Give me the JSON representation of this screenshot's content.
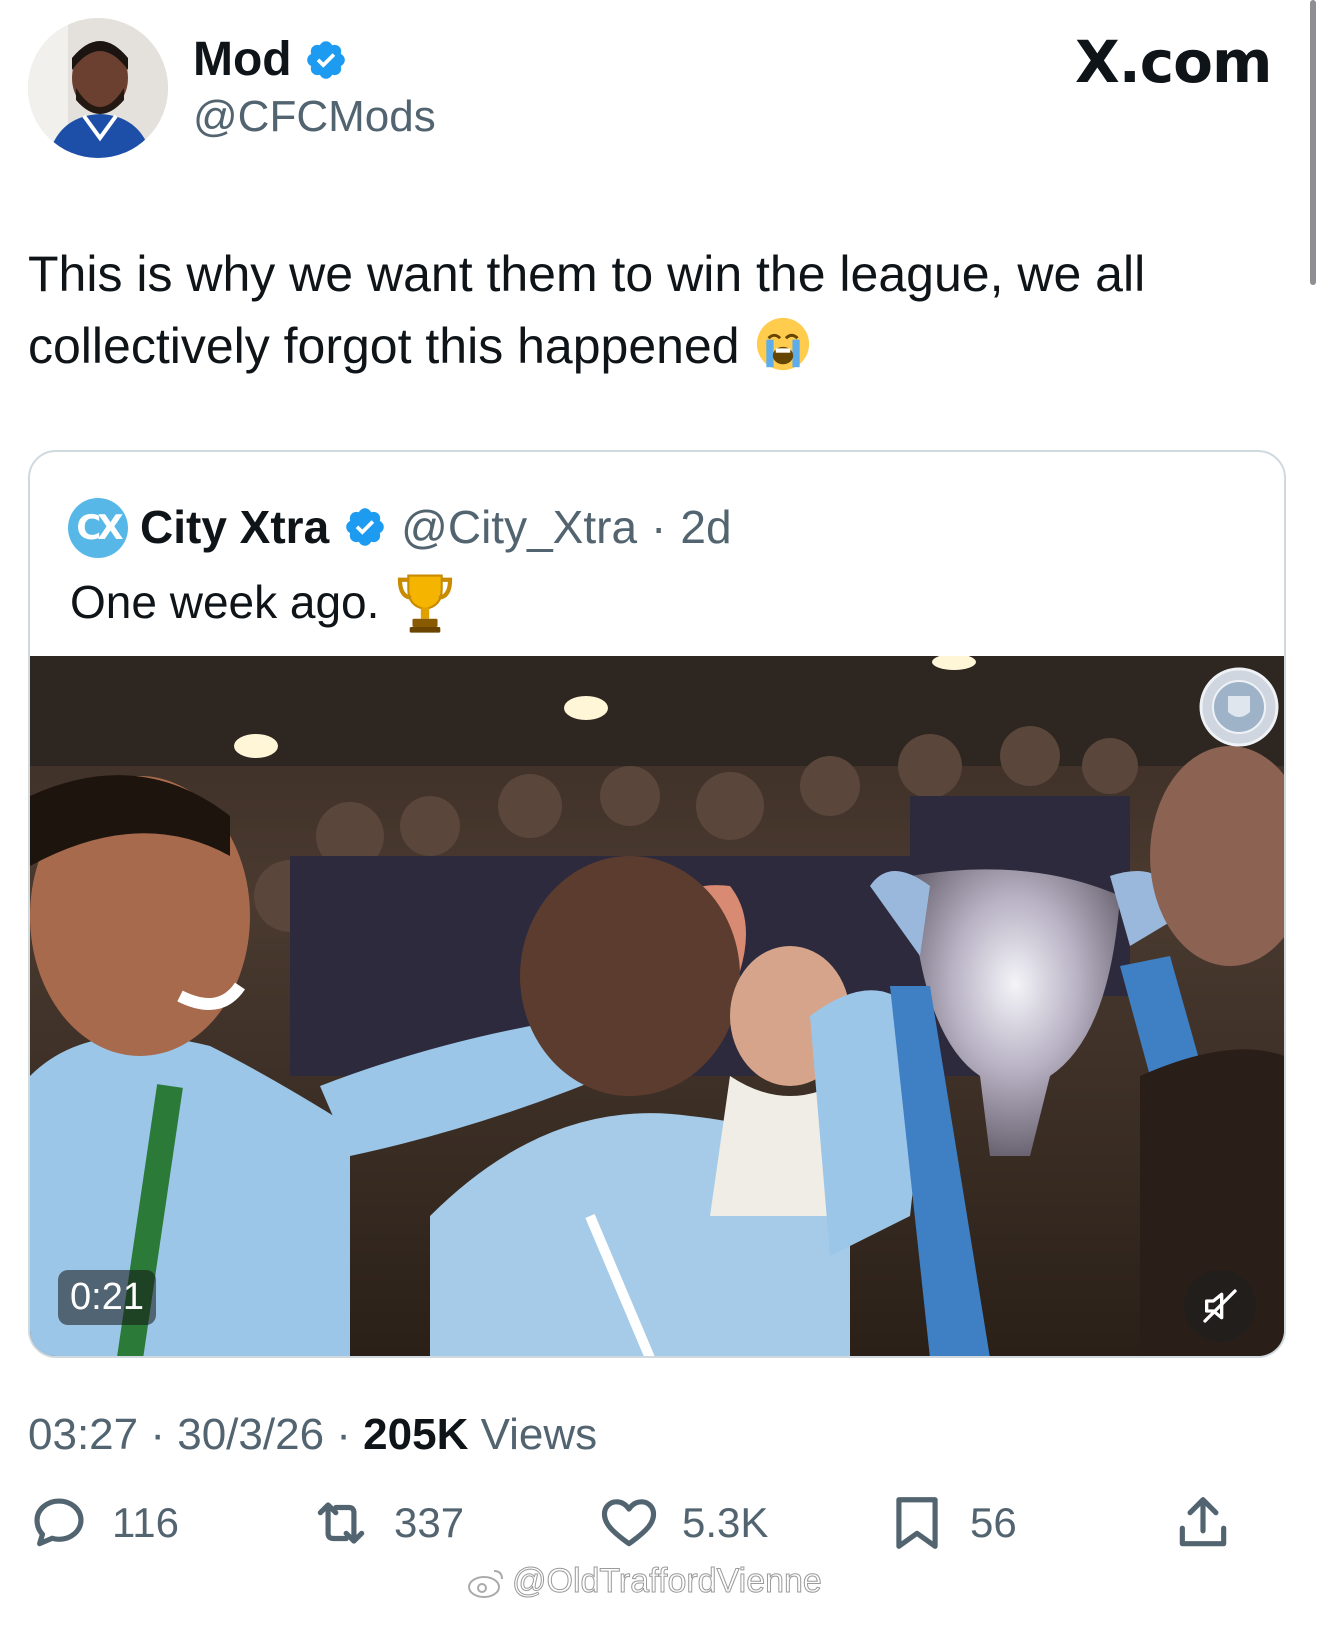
{
  "author": {
    "name": "Mod",
    "handle": "@CFCMods",
    "verified": true
  },
  "brand": "X.com",
  "tweet": {
    "text": "This is why we want them to win the league, we all collectively forgot this happened",
    "emoji": "loudly-crying-face"
  },
  "quoted": {
    "name": "City Xtra",
    "handle": "@City_Xtra",
    "separator": "·",
    "age": "2d",
    "avatar_text": "CX",
    "text": "One week ago.",
    "emoji": "trophy",
    "video": {
      "duration": "0:21",
      "muted": true
    }
  },
  "meta": {
    "time": "03:27",
    "date": "30/3/26",
    "separator": "·",
    "views_count": "205K",
    "views_label": "Views"
  },
  "actions": {
    "replies": "116",
    "reposts": "337",
    "likes": "5.3K",
    "bookmarks": "56"
  },
  "watermark": "@OldTraffordVienne",
  "colors": {
    "verified": "#1d9bf0",
    "text_primary": "#0f1419",
    "text_secondary": "#536471",
    "border": "#cfd9de"
  }
}
